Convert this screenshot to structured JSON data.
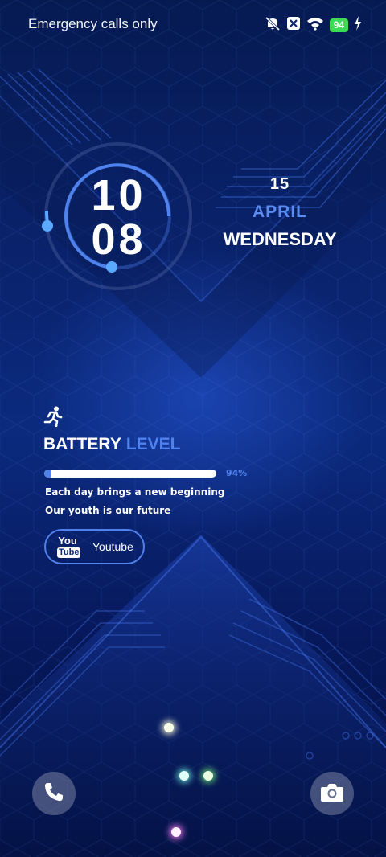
{
  "status_bar": {
    "carrier_text": "Emergency calls only",
    "battery_percent": "94",
    "icons": [
      "mute-icon",
      "no-sim-icon",
      "wifi-icon",
      "battery-icon",
      "charging-bolt-icon"
    ]
  },
  "clock": {
    "hours": "10",
    "minutes": "08"
  },
  "date": {
    "day": "15",
    "month": "APRIL",
    "weekday": "WEDNESDAY"
  },
  "battery_widget": {
    "title_word1": "BATTERY",
    "title_word2": "LEVEL",
    "percent_label": "94%",
    "percent_value": 0.94,
    "quote_line1": "Each day brings a new beginning",
    "quote_line2": "Our youth is our future",
    "icon": "runner-icon"
  },
  "shortcut_app": {
    "logo_you": "You",
    "logo_tube": "Tube",
    "label": "Youtube"
  },
  "lockscreen_shortcuts": {
    "left": "phone-icon",
    "right": "camera-icon"
  },
  "colors": {
    "accent": "#4f82ec",
    "battery_badge": "#3ddc56",
    "background_dark": "#061a52"
  }
}
